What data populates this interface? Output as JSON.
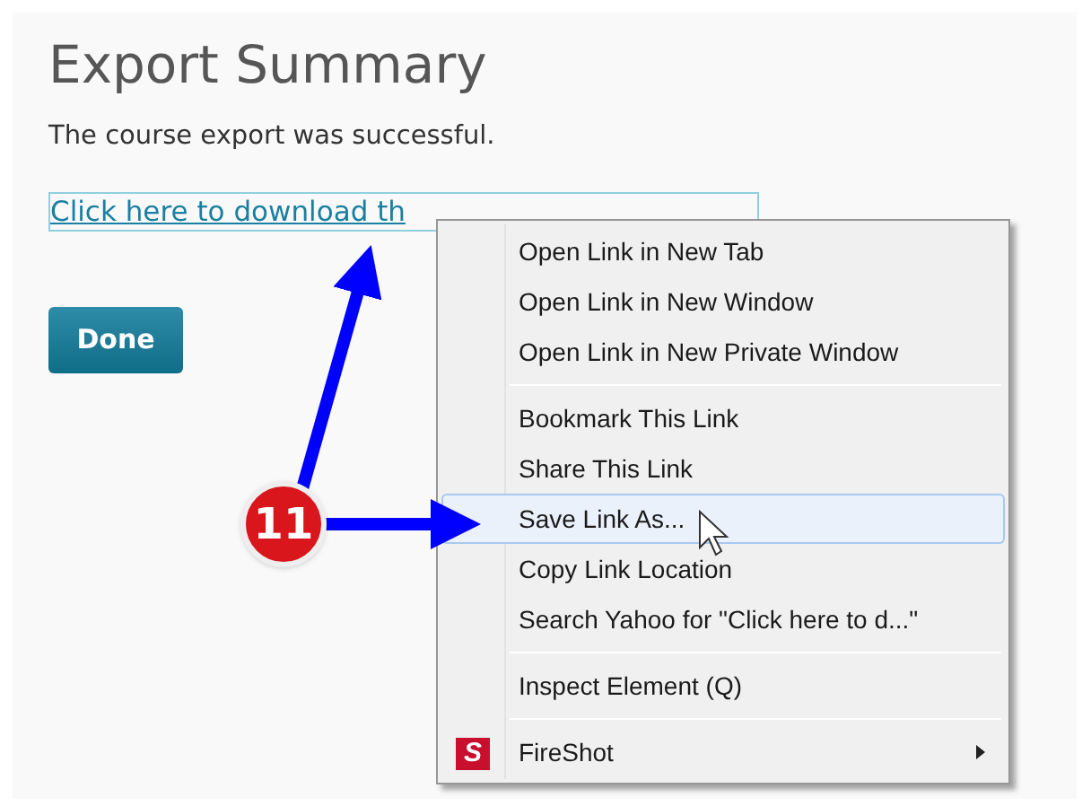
{
  "page": {
    "title": "Export Summary",
    "message": "The course export was successful.",
    "link": "Click here to download th",
    "done_button": "Done"
  },
  "context_menu": {
    "items": [
      {
        "kind": "item",
        "label": "Open Link in New Tab",
        "selected": false
      },
      {
        "kind": "item",
        "label": "Open Link in New Window",
        "selected": false
      },
      {
        "kind": "item",
        "label": "Open Link in New Private Window",
        "selected": false
      },
      {
        "kind": "separator"
      },
      {
        "kind": "item",
        "label": "Bookmark This Link",
        "selected": false
      },
      {
        "kind": "item",
        "label": "Share This Link",
        "selected": false
      },
      {
        "kind": "item",
        "label": "Save Link As...",
        "selected": true
      },
      {
        "kind": "item",
        "label": "Copy Link Location",
        "selected": false
      },
      {
        "kind": "item",
        "label": "Search Yahoo for \"Click here to d...\"",
        "selected": false
      },
      {
        "kind": "separator"
      },
      {
        "kind": "item",
        "label": "Inspect Element (Q)",
        "selected": false
      },
      {
        "kind": "separator"
      },
      {
        "kind": "submenu",
        "label": "FireShot",
        "icon_text": "S",
        "selected": false
      }
    ]
  },
  "annotation": {
    "step": "11"
  }
}
